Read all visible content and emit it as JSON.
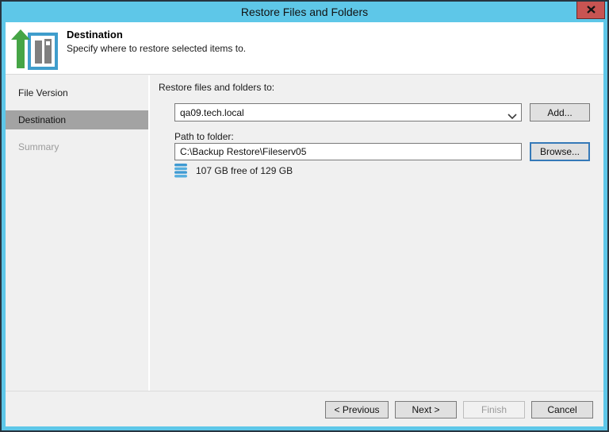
{
  "window": {
    "title": "Restore Files and Folders",
    "close_icon": "close-icon"
  },
  "header": {
    "title": "Destination",
    "subtitle": "Specify where to restore selected items to.",
    "icon": "restore-destination-icon"
  },
  "sidebar": {
    "items": [
      {
        "label": "File Version",
        "state": "done"
      },
      {
        "label": "Destination",
        "state": "active"
      },
      {
        "label": "Summary",
        "state": "upcoming"
      }
    ]
  },
  "main": {
    "restore_to_label": "Restore files and folders to:",
    "server_combo": {
      "value": "qa09.tech.local",
      "chevron_icon": "chevron-down-icon"
    },
    "add_button_label": "Add...",
    "path_label": "Path to folder:",
    "path_value": "C:\\Backup Restore\\Fileserv05",
    "browse_button_label": "Browse...",
    "disk_icon": "disk-stack-icon",
    "disk_space_text": "107 GB free of 129 GB"
  },
  "footer": {
    "previous_label": "< Previous",
    "next_label": "Next >",
    "finish_label": "Finish",
    "cancel_label": "Cancel"
  },
  "colors": {
    "titlebar_blue": "#5ec7e8",
    "frame_dark": "#273540",
    "close_red": "#c85452",
    "client_gray": "#f0f0f0",
    "step_active_bg": "#a3a3a3",
    "step_upcoming_text": "#9b9b9b",
    "focus_border_blue": "#3579b8",
    "disk_icon_blue": "#3f9ad2",
    "arrow_green": "#46a546",
    "building_gray": "#7f7f7f",
    "icon_frame_blue": "#3f9dcc"
  }
}
